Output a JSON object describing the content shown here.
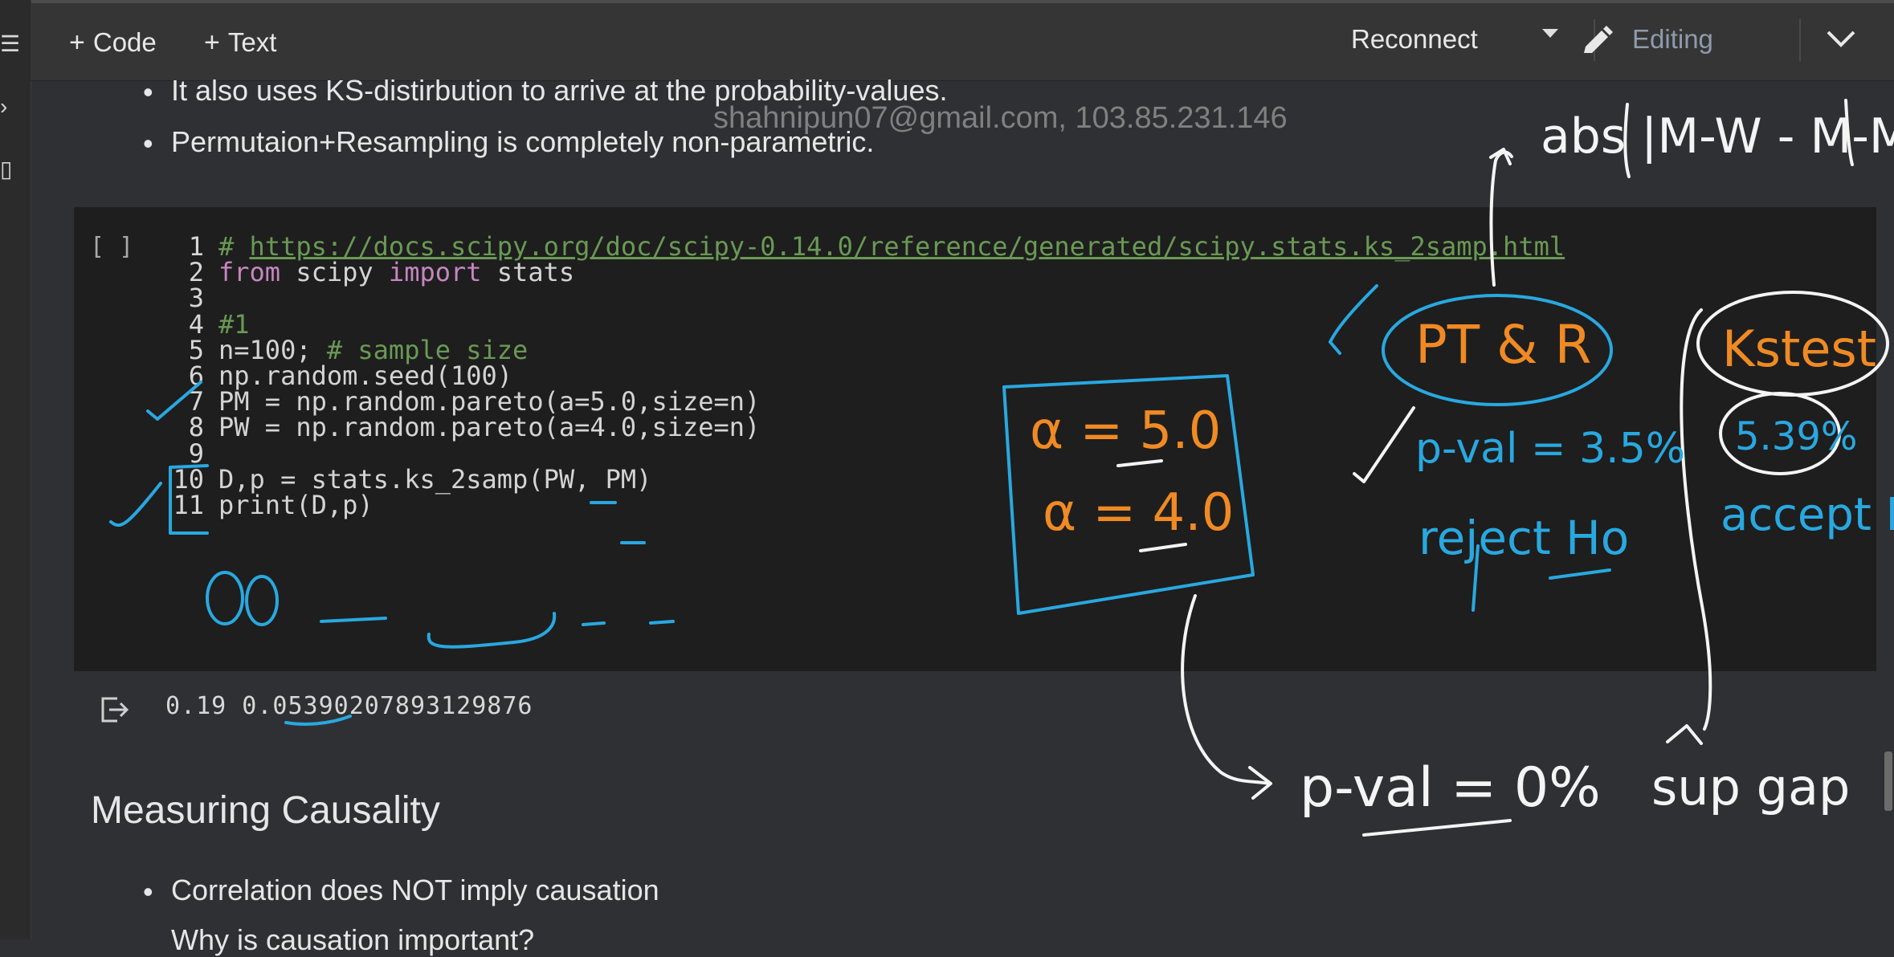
{
  "toolbar": {
    "code_label": "Code",
    "text_label": "Text",
    "reconnect_label": "Reconnect",
    "editing_label": "Editing",
    "plus_glyph": "+"
  },
  "markdown_top": {
    "bullets": [
      "It also uses KS-distirbution to arrive at the probability-values.",
      "Permutaion+Resampling is completely non-parametric."
    ]
  },
  "watermark": "shahnipun07@gmail.com, 103.85.231.146",
  "code_cell": {
    "run_indicator": "[ ]",
    "lines": [
      {
        "n": "1",
        "parts": [
          {
            "t": "# ",
            "c": "cm"
          },
          {
            "t": "https://docs.scipy.org/doc/scipy-0.14.0/reference/generated/scipy.stats.ks_2samp.html",
            "c": "url"
          }
        ]
      },
      {
        "n": "2",
        "parts": [
          {
            "t": "from",
            "c": "kw"
          },
          {
            "t": " scipy ",
            "c": "fn"
          },
          {
            "t": "import",
            "c": "kw"
          },
          {
            "t": " stats",
            "c": "fn"
          }
        ]
      },
      {
        "n": "3",
        "parts": []
      },
      {
        "n": "4",
        "parts": [
          {
            "t": "#1",
            "c": "cm"
          }
        ]
      },
      {
        "n": "5",
        "parts": [
          {
            "t": "n=100; ",
            "c": "fn"
          },
          {
            "t": "# sample size",
            "c": "cm"
          }
        ]
      },
      {
        "n": "6",
        "parts": [
          {
            "t": "np.random.seed(100)",
            "c": "fn"
          }
        ]
      },
      {
        "n": "7",
        "parts": [
          {
            "t": "PM = np.random.pareto(a=5.0,size=n)",
            "c": "fn"
          }
        ]
      },
      {
        "n": "8",
        "parts": [
          {
            "t": "PW = np.random.pareto(a=4.0,size=n)",
            "c": "fn"
          }
        ]
      },
      {
        "n": "9",
        "parts": []
      },
      {
        "n": "10",
        "parts": [
          {
            "t": "D,p = stats.ks_2samp(PW, PM)",
            "c": "fn"
          }
        ]
      },
      {
        "n": "11",
        "parts": [
          {
            "t": "print(D,p)",
            "c": "fn"
          }
        ]
      }
    ],
    "output": "0.19 0.05390207893129876"
  },
  "heading": "Measuring Causality",
  "markdown_bottom": {
    "bullets": [
      "Correlation does NOT imply causation",
      "Why is causation important?"
    ]
  },
  "annotations": {
    "abs_formula": "abs |M-W - M-M|",
    "pt_r": "PT & R",
    "pval_35": "p-val = 3.5%",
    "reject": "reject Ho",
    "ks_test": "Kstest",
    "ks_pval": "5.39%",
    "accept": "accept Ho",
    "alpha1": "α = 5.0",
    "alpha2": "α = 4.0",
    "pval_0": "p-val = 0%",
    "sup_gap": "sup gap",
    "colors": {
      "blue": "#29a8e0",
      "orange": "#f08a24",
      "white": "#f4f4f4"
    }
  }
}
